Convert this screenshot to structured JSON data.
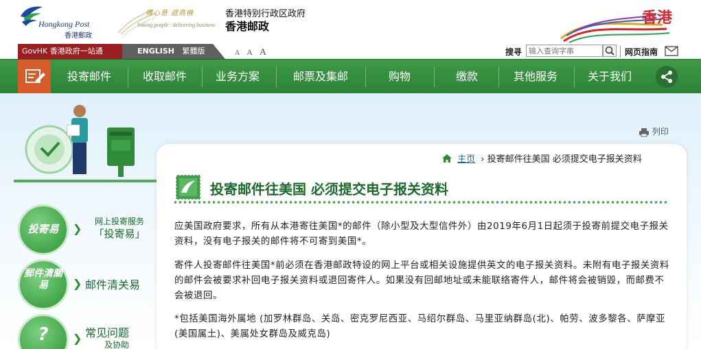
{
  "header": {
    "logo_en": "Hongkong Post",
    "logo_zh": "香港郵政",
    "slogan_zh": "傳心意 遞商機",
    "slogan_en": "linking people · delivering business",
    "gov_line1": "香港特别行政区政府",
    "gov_line2": "香港邮政",
    "brand_hk": "香港"
  },
  "utility": {
    "govhk": "GovHK 香港政府一站通",
    "lang_en": "ENGLISH",
    "lang_tc": "繁體版",
    "font_sizes": [
      "A",
      "A",
      "A"
    ],
    "search_label": "搜寻",
    "search_placeholder": "输入查询字串",
    "sitemap": "网页指南"
  },
  "nav": {
    "items": [
      "投寄邮件",
      "收取邮件",
      "业务方案",
      "邮票及集邮",
      "购物",
      "缴款",
      "其他服务",
      "关于我们"
    ]
  },
  "sidebar": {
    "items": [
      {
        "badge": "投寄易",
        "line1": "网上投寄服务",
        "line2": "「投寄易」"
      },
      {
        "badge": "郵件清關易",
        "line1": "邮件清关易",
        "line2": ""
      },
      {
        "badge": "?",
        "line1": "常见问题",
        "line2": "及协助"
      }
    ]
  },
  "content": {
    "print": "列印",
    "breadcrumb_home": "主页",
    "breadcrumb_current": "投寄邮件往美国 必须提交电子报关资料",
    "title": "投寄邮件往美国 必须提交电子报关资料",
    "paragraphs": [
      "应美国政府要求，所有从本港寄往美国*的邮件（除小型及大型信件外）由2019年6月1日起须于投寄前提交电子报关资料，没有电子报关的邮件将不可寄到美国*。",
      "寄件人投寄邮件往美国*前必须在香港邮政特设的网上平台或相关设施提供英文的电子报关资料。未附有电子报关资料的邮件会被要求补回电子报关资料或退回寄件人。如果没有回邮地址或未能联络寄件人，邮件将会被销毁，而邮费不会被退回。",
      "*包括美国海外属地 (加罗林群岛、关岛、密克罗尼西亚、马绍尔群岛、马里亚纳群岛(北)、帕劳、波多黎各、萨摩亚(美国属土)、美属处女群岛及威克岛)"
    ]
  }
}
